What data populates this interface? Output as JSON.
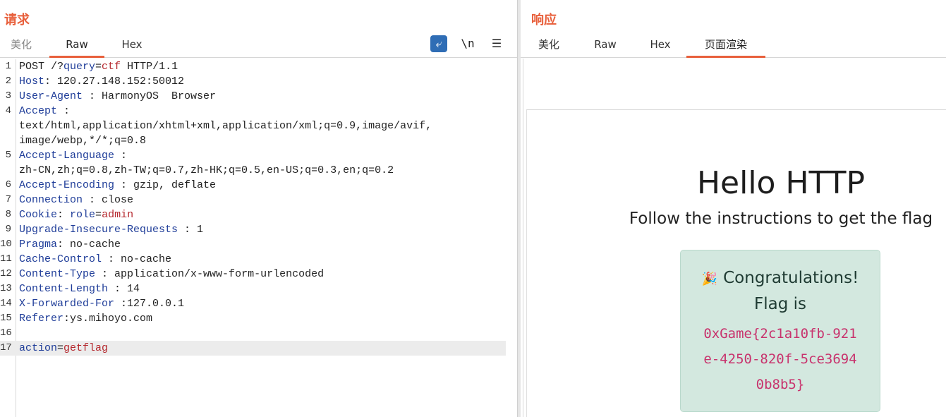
{
  "request": {
    "title": "请求",
    "tabs": [
      "美化",
      "Raw",
      "Hex"
    ],
    "active_tab": "Raw",
    "toolbar": {
      "wrap_icon": "⤶",
      "newline_label": "\\n",
      "menu_icon": "☰"
    },
    "lines": [
      {
        "n": "1",
        "parts": [
          {
            "t": "POST /?",
            "c": "val"
          },
          {
            "t": "query",
            "c": "pname"
          },
          {
            "t": "=",
            "c": "val"
          },
          {
            "t": "ctf",
            "c": "pval"
          },
          {
            "t": " HTTP/1.1",
            "c": "val"
          }
        ]
      },
      {
        "n": "2",
        "parts": [
          {
            "t": "Host",
            "c": "hdr"
          },
          {
            "t": ": 120.27.148.152:50012",
            "c": "val"
          }
        ]
      },
      {
        "n": "3",
        "parts": [
          {
            "t": "User-Agent",
            "c": "hdr"
          },
          {
            "t": " : HarmonyOS  Browser",
            "c": "val"
          }
        ]
      },
      {
        "n": "4",
        "parts": [
          {
            "t": "Accept",
            "c": "hdr"
          },
          {
            "t": " :",
            "c": "val"
          }
        ]
      },
      {
        "n": "",
        "parts": [
          {
            "t": "text/html,application/xhtml+xml,application/xml;q=0.9,image/avif,",
            "c": "val"
          }
        ]
      },
      {
        "n": "",
        "parts": [
          {
            "t": "image/webp,*/*;q=0.8",
            "c": "val"
          }
        ]
      },
      {
        "n": "5",
        "parts": [
          {
            "t": "Accept-Language",
            "c": "hdr"
          },
          {
            "t": " :",
            "c": "val"
          }
        ]
      },
      {
        "n": "",
        "parts": [
          {
            "t": "zh-CN,zh;q=0.8,zh-TW;q=0.7,zh-HK;q=0.5,en-US;q=0.3,en;q=0.2",
            "c": "val"
          }
        ]
      },
      {
        "n": "6",
        "parts": [
          {
            "t": "Accept-Encoding",
            "c": "hdr"
          },
          {
            "t": " : gzip, deflate",
            "c": "val"
          }
        ]
      },
      {
        "n": "7",
        "parts": [
          {
            "t": "Connection",
            "c": "hdr"
          },
          {
            "t": " : close",
            "c": "val"
          }
        ]
      },
      {
        "n": "8",
        "parts": [
          {
            "t": "Cookie",
            "c": "hdr"
          },
          {
            "t": ": ",
            "c": "val"
          },
          {
            "t": "role",
            "c": "pname"
          },
          {
            "t": "=",
            "c": "val"
          },
          {
            "t": "admin",
            "c": "pval"
          }
        ]
      },
      {
        "n": "9",
        "parts": [
          {
            "t": "Upgrade-Insecure-Requests",
            "c": "hdr"
          },
          {
            "t": " : 1",
            "c": "val"
          }
        ]
      },
      {
        "n": "10",
        "parts": [
          {
            "t": "Pragma",
            "c": "hdr"
          },
          {
            "t": ": no-cache",
            "c": "val"
          }
        ]
      },
      {
        "n": "11",
        "parts": [
          {
            "t": "Cache-Control",
            "c": "hdr"
          },
          {
            "t": " : no-cache",
            "c": "val"
          }
        ]
      },
      {
        "n": "12",
        "parts": [
          {
            "t": "Content-Type",
            "c": "hdr"
          },
          {
            "t": " : application/x-www-form-urlencoded",
            "c": "val"
          }
        ]
      },
      {
        "n": "13",
        "parts": [
          {
            "t": "Content-Length",
            "c": "hdr"
          },
          {
            "t": " : 14",
            "c": "val"
          }
        ]
      },
      {
        "n": "14",
        "parts": [
          {
            "t": "X-Forwarded-For",
            "c": "hdr"
          },
          {
            "t": " :127.0.0.1",
            "c": "val"
          }
        ]
      },
      {
        "n": "15",
        "parts": [
          {
            "t": "Referer",
            "c": "hdr"
          },
          {
            "t": ":ys.mihoyo.com",
            "c": "val"
          }
        ]
      },
      {
        "n": "16",
        "parts": []
      },
      {
        "n": "17",
        "highlight": true,
        "parts": [
          {
            "t": "action",
            "c": "pname"
          },
          {
            "t": "=",
            "c": "val"
          },
          {
            "t": "getflag",
            "c": "pval"
          }
        ]
      }
    ]
  },
  "response": {
    "title": "响应",
    "tabs": [
      "美化",
      "Raw",
      "Hex",
      "页面渲染"
    ],
    "active_tab": "页面渲染",
    "page": {
      "heading": "Hello HTTP",
      "subtitle": "Follow the instructions to get the flag",
      "alert_icon": "🎉",
      "alert_line1": "Congratulations!",
      "alert_line2": "Flag is",
      "flag": "0xGame{2c1a10fb-921e-4250-820f-5ce36940b8b5}"
    }
  },
  "colors": {
    "accent": "#e8603c",
    "header_name": "#1f3d99",
    "param_value": "#b5282e",
    "flag": "#c8336d",
    "alert_bg": "#d3e8df"
  }
}
